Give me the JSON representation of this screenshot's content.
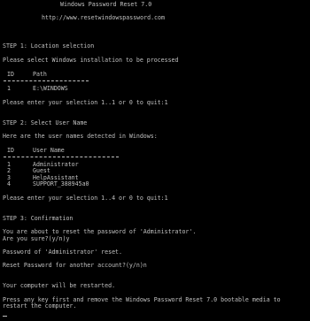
{
  "header": {
    "title": "Windows Password Reset 7.0",
    "url": "http://www.resetwindowspassword.com"
  },
  "step1": {
    "heading": "STEP 1: Location selection",
    "instruction": "Please select Windows installation to be processed",
    "col_id": "ID",
    "col_path": "Path",
    "rows": [
      {
        "id": "1",
        "path": "E:\\WINDOWS"
      }
    ],
    "prompt": "Please enter your selection 1..1 or 0 to quit:1"
  },
  "step2": {
    "heading": "STEP 2: Select User Name",
    "instruction": "Here are the user names detected in Windows:",
    "col_id": "ID",
    "col_user": "User Name",
    "rows": [
      {
        "id": "1",
        "user": "Administrator"
      },
      {
        "id": "2",
        "user": "Guest"
      },
      {
        "id": "3",
        "user": "HelpAssistant"
      },
      {
        "id": "4",
        "user": "SUPPORT_388945a0"
      }
    ],
    "prompt": "Please enter your selection 1..4 or 0 to quit:1"
  },
  "step3": {
    "heading": "STEP 3: Confirmation",
    "confirm_line1": "You are about to reset the password of 'Administrator'.",
    "confirm_line2": "Are you sure?(y/n)y",
    "result": "Password of 'Administrator' reset.",
    "another": "Reset Password for another account?(y/n)n"
  },
  "footer": {
    "restart": "Your computer will be restarted.",
    "remove_line1": "Press any key first and remove the Windows Password Reset 7.0 bootable media to",
    "remove_line2": "restart the computer."
  },
  "colors": {
    "background": "#000000",
    "text": "#c0c0c0"
  }
}
